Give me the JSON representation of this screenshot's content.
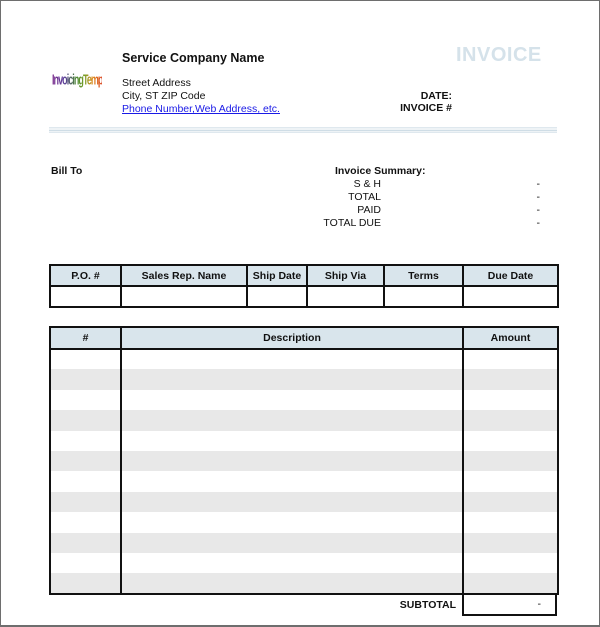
{
  "document": {
    "type": "invoice",
    "title": "INVOICE"
  },
  "colors": {
    "header_fill": "#d9e5ec",
    "title_color": "#d5e2ea",
    "link_color": "#1a1ae6",
    "stripe_gray": "#e8e8e8"
  },
  "logo": {
    "text": "InvoicingTemplates",
    "icon": "invoicing-templates-logo"
  },
  "company": {
    "name": "Service Company Name",
    "street": "Street Address",
    "city_line": "City, ST  ZIP Code",
    "contact_link": "Phone Number,Web Address, etc."
  },
  "meta": {
    "date_label": "DATE:",
    "date_value": "",
    "invoice_no_label": "INVOICE #",
    "invoice_no_value": ""
  },
  "bill_to": {
    "label": "Bill To"
  },
  "summary": {
    "title": "Invoice Summary:",
    "rows": [
      {
        "label": "S & H",
        "value": "-"
      },
      {
        "label": "TOTAL",
        "value": "-"
      },
      {
        "label": "PAID",
        "value": "-"
      },
      {
        "label": "TOTAL DUE",
        "value": "-"
      }
    ]
  },
  "shipping_table": {
    "headers": [
      "P.O. #",
      "Sales Rep. Name",
      "Ship Date",
      "Ship Via",
      "Terms",
      "Due Date"
    ],
    "row": [
      "",
      "",
      "",
      "",
      "",
      ""
    ]
  },
  "items_table": {
    "headers": [
      "#",
      "Description",
      "Amount"
    ],
    "row_count": 12
  },
  "subtotal": {
    "label": "SUBTOTAL",
    "value": "-"
  }
}
